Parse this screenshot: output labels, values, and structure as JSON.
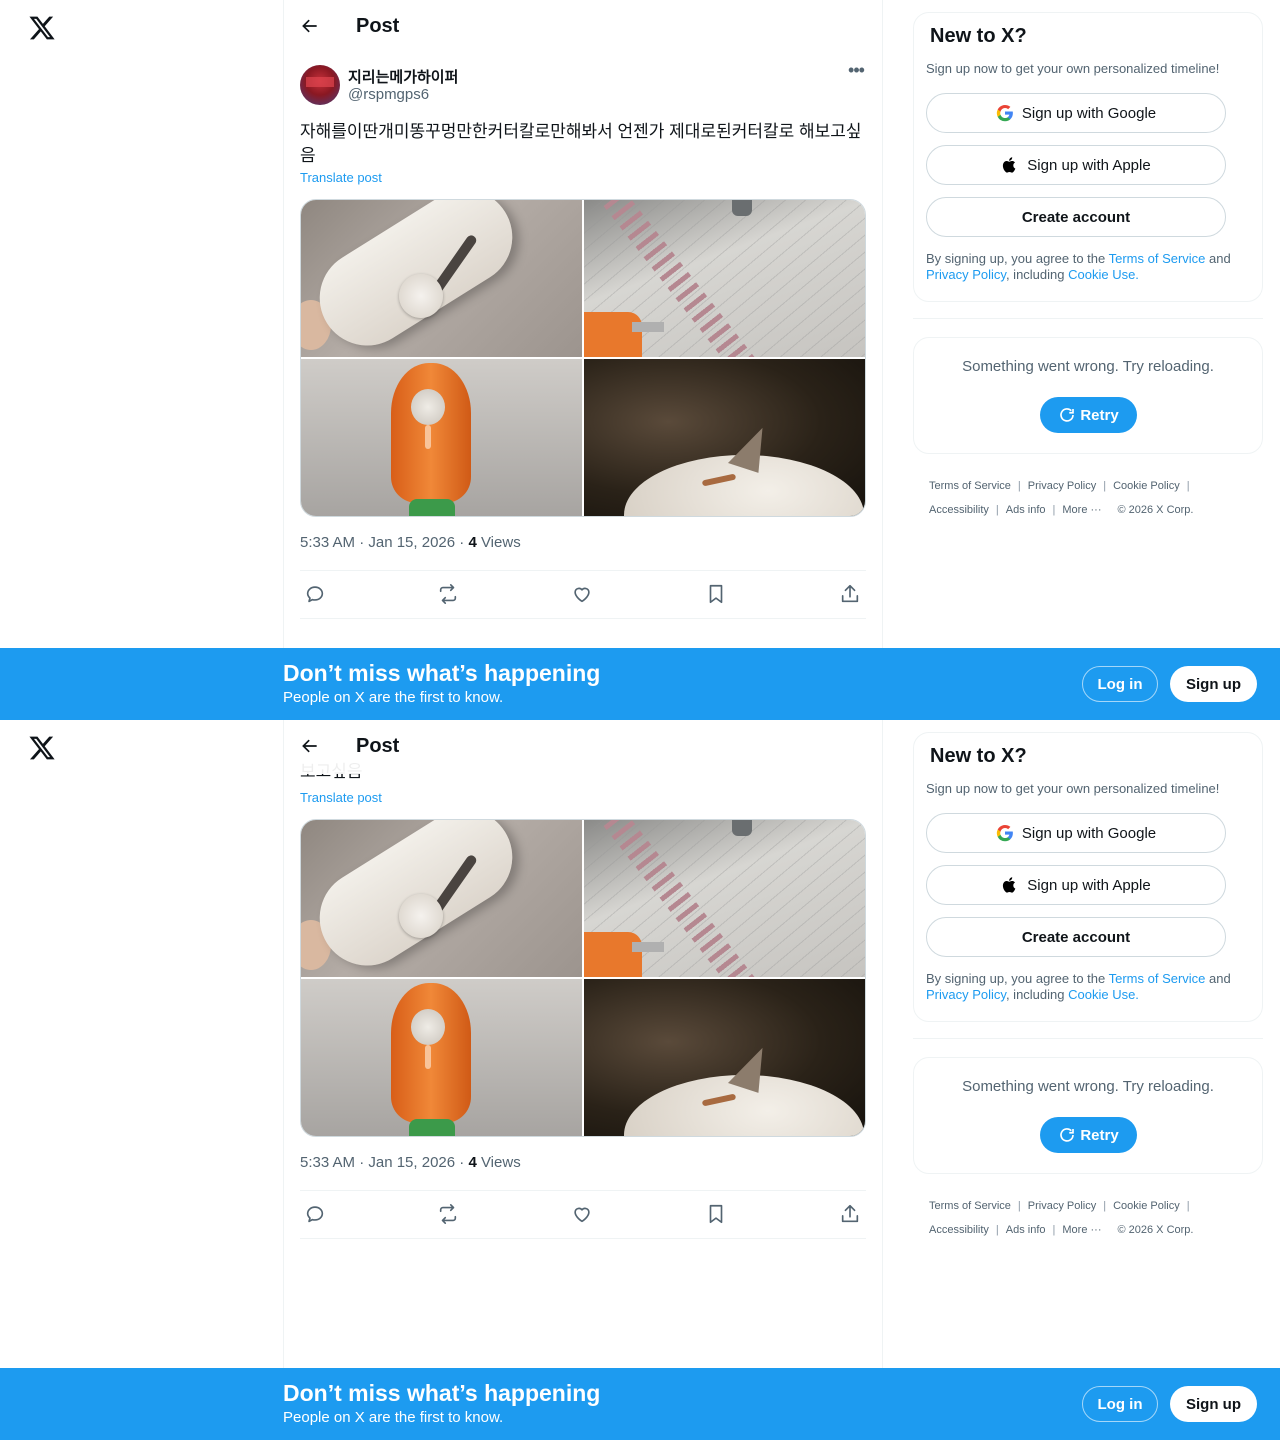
{
  "brand": {
    "logo": "x-logo-icon"
  },
  "header": {
    "title": "Post",
    "back_icon": "arrow-left-icon"
  },
  "post": {
    "author_name": "지리는메가하이퍼",
    "author_handle": "@rspmgps6",
    "more_icon": "more-horizontal-icon",
    "text": "자해를이딴개미똥꾸멍만한커터칼로만해봐서 언젠가 제대로된커터칼로 해보고싶음",
    "text_tail": "보고싶음",
    "translate_label": "Translate post",
    "time": "5:33 AM · Jan 15, 2026 · ",
    "views_count": "4",
    "views_label": " Views",
    "media": [
      {
        "alt": "white utility cutter held in hand"
      },
      {
        "alt": "orange cutter near a spiral notebook"
      },
      {
        "alt": "orange carrot-shaped cutter"
      },
      {
        "alt": "cutter blade tip close-up"
      }
    ],
    "actions": [
      "reply-icon",
      "repost-icon",
      "like-icon",
      "bookmark-icon",
      "share-icon"
    ]
  },
  "sidebar": {
    "signup": {
      "title": "New to X?",
      "subtitle": "Sign up now to get your own personalized timeline!",
      "google_label": "Sign up with Google",
      "apple_label": "Sign up with Apple",
      "create_label": "Create account",
      "legal_prefix": "By signing up, you agree to the ",
      "terms": "Terms of Service",
      "and": " and ",
      "privacy": "Privacy Policy",
      "including": ", including ",
      "cookie": "Cookie Use."
    },
    "error": {
      "message": "Something went wrong. Try reloading.",
      "retry_label": "Retry"
    },
    "footer": {
      "terms": "Terms of Service",
      "privacy": "Privacy Policy",
      "cookie": "Cookie Policy",
      "accessibility": "Accessibility",
      "ads": "Ads info",
      "more": "More ···",
      "copyright": "© 2026 X Corp."
    }
  },
  "banner": {
    "title": "Don’t miss what’s happening",
    "subtitle": "People on X are the first to know.",
    "login_label": "Log in",
    "signup_label": "Sign up"
  },
  "colors": {
    "accent": "#1d9bf0",
    "text": "#0f1419",
    "muted": "#536471",
    "border": "#eff3f4"
  }
}
